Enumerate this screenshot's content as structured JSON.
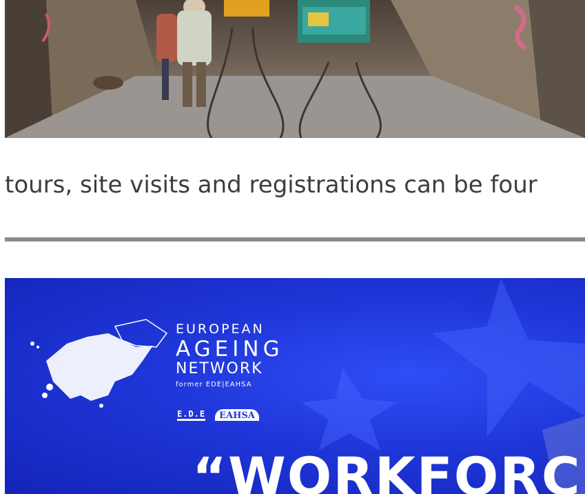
{
  "intro_text": "tours, site visits and registrations can be four",
  "banner": {
    "org_line1": "EUROPEAN",
    "org_line2": "AGEING",
    "org_line3": "NETWORK",
    "org_former": "former EDE|EAHSA",
    "partner_logo_1": "E.D.E",
    "partner_logo_2": "EAHSA",
    "headline": "“WORKFORC"
  },
  "colors": {
    "banner_blue": "#1f36d8",
    "divider_gray": "#8b8b8b",
    "text_gray": "#3c3c3c"
  }
}
